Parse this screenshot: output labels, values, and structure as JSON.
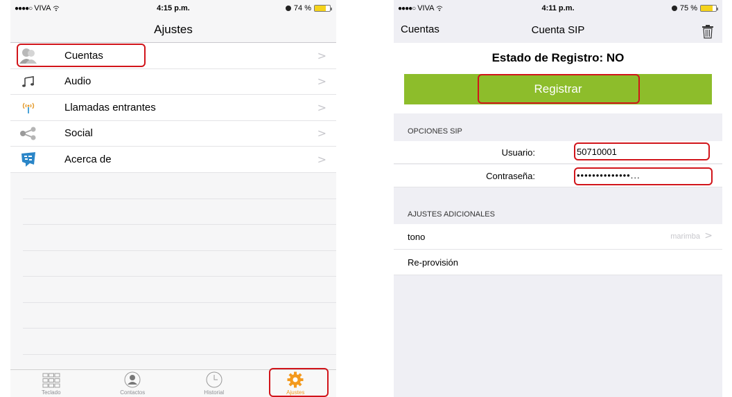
{
  "left": {
    "status": {
      "carrier": "VIVA",
      "signal_dots": "●●●●○",
      "time": "4:15 p.m.",
      "battery": "74 %",
      "battery_level": 0.74
    },
    "title": "Ajustes",
    "items": [
      {
        "label": "Cuentas",
        "icon": "user-icon"
      },
      {
        "label": "Audio",
        "icon": "music-note-icon"
      },
      {
        "label": "Llamadas entrantes",
        "icon": "antenna-icon"
      },
      {
        "label": "Social",
        "icon": "share-icon"
      },
      {
        "label": "Acerca de",
        "icon": "hablame-logo-icon"
      }
    ],
    "chevron": ">",
    "tabs": [
      {
        "label": "Teclado",
        "icon": "keypad-icon"
      },
      {
        "label": "Contactos",
        "icon": "contacts-icon"
      },
      {
        "label": "Historial",
        "icon": "clock-icon"
      },
      {
        "label": "Ajustes",
        "icon": "gear-icon"
      }
    ]
  },
  "right": {
    "status": {
      "carrier": "VIVA",
      "signal_dots": "●●●●○",
      "time": "4:11 p.m.",
      "battery": "75 %",
      "battery_level": 0.75
    },
    "nav_back": "Cuentas",
    "title": "Cuenta SIP",
    "registration_status": "Estado de Registro: NO",
    "register_button": "Registrar",
    "section_sip": "OPCIONES SIP",
    "user_label": "Usuario:",
    "user_value": "50710001",
    "password_label": "Contraseña:",
    "password_value": "••••••••••••••...",
    "section_extra": "AJUSTES ADICIONALES",
    "tone_label": "tono",
    "tone_value": "marimba",
    "chevron": ">",
    "reprovision_label": "Re-provisión"
  },
  "colors": {
    "accent_green": "#8dbd2b",
    "highlight_red": "#d1141a",
    "tab_active": "#f39a1e"
  }
}
